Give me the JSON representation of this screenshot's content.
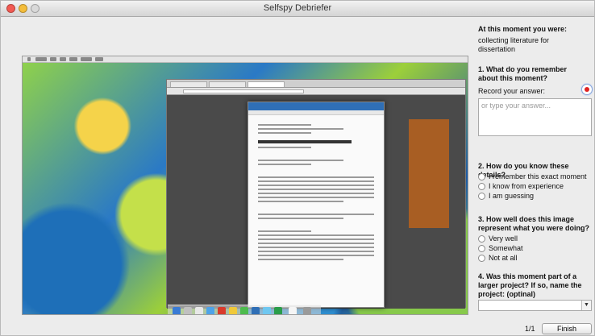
{
  "window": {
    "title": "Selfspy Debriefer"
  },
  "context": {
    "heading": "At this moment you were:",
    "activity": "collecting literature for dissertation"
  },
  "q1": {
    "question": "1. What do you remember about this moment?",
    "record_label": "Record your answer:",
    "answer_value": "",
    "answer_placeholder": "or type your answer..."
  },
  "q2": {
    "question": "2. How do you know these details?",
    "options": [
      "I remember this exact moment",
      "I know from experience",
      "I am guessing"
    ]
  },
  "q3": {
    "question": "3. How well does this image represent what you were doing?",
    "options": [
      "Very well",
      "Somewhat",
      "Not at all"
    ]
  },
  "q4": {
    "question": "4. Was this moment part of a larger project? If so, name the project: (optinal)",
    "combo_value": ""
  },
  "footer": {
    "pager": "1/1",
    "finish_label": "Finish"
  },
  "screenshot_preview": {
    "document_title": "A revival of Romance roots",
    "heading_intro": "Introduction"
  }
}
